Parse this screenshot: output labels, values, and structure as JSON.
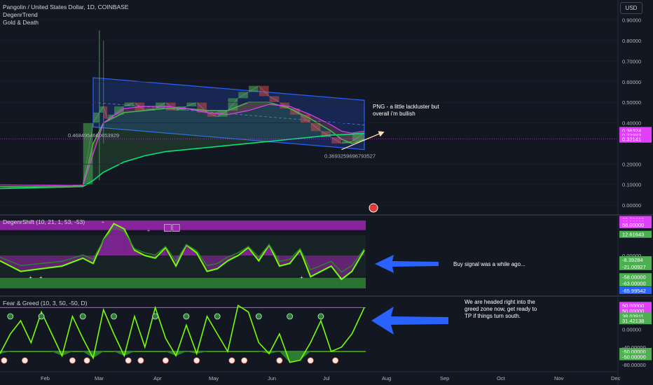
{
  "header": {
    "symbol": "Pangolin / United States Dollar, 1D, COINBASE",
    "indicator1": "DegenrTrend",
    "indicator2": "Gold & Death",
    "currency": "USD"
  },
  "panes": {
    "degenr_shift": "DegenrShift (10, 21, 1, 53, -53)",
    "fear_greed": "Fear & Greed (10, 3, 50, -50, D)"
  },
  "annotations": {
    "png_note": [
      "PNG - a little lackluster but",
      "overall i'm bullish"
    ],
    "buy_signal": "Buy signal was a while ago...",
    "greed_note": [
      "We are headed right into the",
      "greed zone now, get ready to",
      "TP if things turn south."
    ]
  },
  "channel_labels": {
    "upper_left": "0.4684954660653929",
    "lower_right": "0.3693259696793527"
  },
  "colors": {
    "background": "#131722",
    "channel": "#2962ff",
    "pink_ma": "#e040fb",
    "green_ma": "#4caf50",
    "osc_green": "#4caf50",
    "osc_purple": "#9c27b0",
    "arrow_blue": "#2962ff"
  },
  "chart_data": [
    {
      "type": "line",
      "title": "Pangolin / United States Dollar, 1D, COINBASE",
      "ylim": [
        0,
        0.95
      ],
      "y_ticks": [
        "0.90000",
        "0.80000",
        "0.70000",
        "0.60000",
        "0.50000",
        "0.40000",
        "0.20000",
        "0.10000",
        "0.00000"
      ],
      "x_ticks": [
        "Feb",
        "Mar",
        "Apr",
        "May",
        "Jun",
        "Jul",
        "Aug",
        "Sep",
        "Oct",
        "Nov",
        "Dec"
      ],
      "price_labels": [
        {
          "text": "0.36324",
          "value": 0.363,
          "color": "#e040fb"
        },
        {
          "text": "0.33983",
          "value": 0.34,
          "color": "#e040fb"
        },
        {
          "text": "0.32141",
          "value": 0.321,
          "color": "#e040fb"
        }
      ],
      "series": [
        {
          "name": "close",
          "x": [
            0,
            10,
            20,
            30,
            35,
            40,
            45,
            48,
            50,
            52,
            55,
            60,
            65,
            70,
            75,
            80,
            85,
            90,
            95,
            100,
            105,
            110,
            115,
            120,
            125,
            130,
            135,
            140,
            145,
            150,
            155,
            160,
            165,
            170,
            176
          ],
          "values": [
            0.09,
            0.085,
            0.09,
            0.085,
            0.09,
            0.1,
            0.4,
            0.45,
            0.48,
            0.42,
            0.44,
            0.48,
            0.5,
            0.46,
            0.47,
            0.5,
            0.46,
            0.48,
            0.5,
            0.45,
            0.43,
            0.46,
            0.52,
            0.55,
            0.58,
            0.53,
            0.5,
            0.47,
            0.44,
            0.4,
            0.36,
            0.33,
            0.3,
            0.31,
            0.35
          ]
        },
        {
          "name": "ma_fast",
          "x": [
            0,
            40,
            45,
            50,
            60,
            70,
            80,
            90,
            100,
            110,
            120,
            130,
            140,
            150,
            160,
            165,
            170,
            176
          ],
          "values": [
            0.09,
            0.09,
            0.3,
            0.4,
            0.45,
            0.46,
            0.47,
            0.47,
            0.46,
            0.46,
            0.5,
            0.5,
            0.47,
            0.42,
            0.36,
            0.32,
            0.3,
            0.32
          ]
        },
        {
          "name": "ma_slow",
          "x": [
            0,
            40,
            45,
            50,
            60,
            70,
            80,
            90,
            100,
            110,
            120,
            130,
            140,
            150,
            160,
            170,
            176
          ],
          "values": [
            0.08,
            0.09,
            0.12,
            0.16,
            0.21,
            0.24,
            0.26,
            0.27,
            0.28,
            0.29,
            0.3,
            0.31,
            0.32,
            0.33,
            0.34,
            0.345,
            0.35
          ]
        },
        {
          "name": "pink_ma",
          "x": [
            0,
            40,
            45,
            50,
            60,
            70,
            80,
            90,
            100,
            110,
            120,
            130,
            140,
            150,
            160,
            165,
            170,
            176
          ],
          "values": [
            0.1,
            0.095,
            0.25,
            0.4,
            0.47,
            0.48,
            0.48,
            0.47,
            0.45,
            0.44,
            0.46,
            0.49,
            0.48,
            0.44,
            0.39,
            0.36,
            0.35,
            0.36
          ]
        }
      ]
    },
    {
      "type": "area",
      "title": "DegenrShift (10, 21, 1, 53, -53)",
      "ylim": [
        -70,
        70
      ],
      "y_labels": [
        {
          "text": "68.00000",
          "value": 68,
          "color": "#e040fb"
        },
        {
          "text": "63.00000",
          "value": 63,
          "color": "#e040fb"
        },
        {
          "text": "58.00000",
          "value": 58,
          "color": "#e040fb"
        },
        {
          "text": "12.61643",
          "value": 40,
          "color": "#4caf50"
        },
        {
          "text": "0.00000",
          "value": 0,
          "color": "none"
        },
        {
          "text": "-8.39284",
          "value": -8,
          "color": "#4caf50"
        },
        {
          "text": "-21.00927",
          "value": -21,
          "color": "#4caf50"
        },
        {
          "text": "-58.00000",
          "value": -40,
          "color": "#4caf50"
        },
        {
          "text": "-63.00000",
          "value": -52,
          "color": "#4caf50"
        },
        {
          "text": "-65.99542",
          "value": -66,
          "color": "#2962ff"
        }
      ],
      "series": [
        {
          "name": "shift",
          "x": [
            0,
            10,
            20,
            30,
            40,
            45,
            50,
            55,
            60,
            65,
            70,
            75,
            80,
            85,
            90,
            95,
            100,
            105,
            110,
            115,
            120,
            125,
            130,
            135,
            140,
            145,
            150,
            155,
            160,
            165,
            170,
            176
          ],
          "values": [
            -10,
            -30,
            -25,
            -20,
            -5,
            -15,
            30,
            60,
            50,
            10,
            0,
            -5,
            15,
            -20,
            20,
            5,
            -30,
            -25,
            -10,
            0,
            15,
            -10,
            20,
            -20,
            -15,
            10,
            -40,
            -30,
            -20,
            -45,
            -30,
            10
          ]
        }
      ]
    },
    {
      "type": "line",
      "title": "Fear & Greed (10, 3, 50, -50, D)",
      "ylim": [
        -85,
        65
      ],
      "y_labels": [
        {
          "text": "50.00000",
          "value": 55,
          "color": "#e040fb"
        },
        {
          "text": "50.00000",
          "value": 43,
          "color": "#e040fb"
        },
        {
          "text": "38.03911",
          "value": 31,
          "color": "#4caf50"
        },
        {
          "text": "31.42138",
          "value": 20,
          "color": "#4caf50"
        },
        {
          "text": "0.00000",
          "value": 0,
          "color": "none"
        },
        {
          "text": "-40.00000",
          "value": -40,
          "color": "none"
        },
        {
          "text": "-50.00000",
          "value": -50,
          "color": "#4caf50"
        },
        {
          "text": "-50.00000",
          "value": -62,
          "color": "#4caf50"
        },
        {
          "text": "-80.00000",
          "value": -80,
          "color": "none"
        }
      ],
      "series": [
        {
          "name": "fear_greed",
          "x": [
            0,
            5,
            10,
            15,
            20,
            25,
            30,
            35,
            40,
            45,
            50,
            55,
            60,
            65,
            70,
            75,
            80,
            85,
            90,
            95,
            100,
            105,
            110,
            115,
            120,
            125,
            130,
            135,
            140,
            145,
            150,
            155,
            160,
            165,
            170,
            176
          ],
          "values": [
            -55,
            -10,
            20,
            -30,
            40,
            -10,
            -60,
            30,
            -20,
            -65,
            45,
            -10,
            -60,
            30,
            -40,
            50,
            -20,
            -60,
            10,
            -55,
            30,
            -10,
            -50,
            55,
            40,
            -30,
            -55,
            -10,
            -75,
            -70,
            -30,
            20,
            -50,
            -40,
            -10,
            50
          ]
        }
      ]
    }
  ]
}
